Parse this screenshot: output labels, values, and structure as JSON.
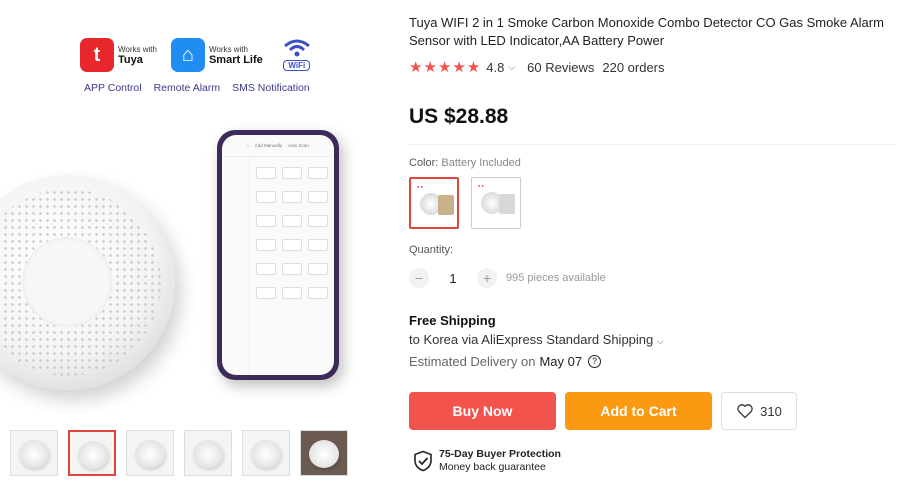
{
  "gallery": {
    "apps": [
      {
        "small": "Works with",
        "name": "Tuya",
        "icon": "tuya-app-icon"
      },
      {
        "small": "Works with",
        "name": "Smart Life",
        "icon": "smart-life-app-icon"
      }
    ],
    "wifi_badge": "WiFi",
    "captions": [
      "APP Control",
      "Remote Alarm",
      "SMS Notification"
    ],
    "thumbnail_count": 6
  },
  "product": {
    "title": "Tuya WIFI 2 in 1 Smoke Carbon Monoxide Combo Detector CO Gas Smoke Alarm Sensor with LED Indicator,AA Battery Power",
    "rating": "4.8",
    "stars": 5,
    "reviews": "60 Reviews",
    "orders": "220 orders",
    "price": "US $28.88"
  },
  "variant": {
    "label": "Color:",
    "selected": "Battery Included"
  },
  "quantity": {
    "label": "Quantity:",
    "minus": "−",
    "value": "1",
    "plus": "+",
    "available": "995 pieces available"
  },
  "shipping": {
    "title": "Free Shipping",
    "line": "to Korea via AliExpress Standard Shipping",
    "delivery_label": "Estimated Delivery on",
    "delivery_date": "May 07"
  },
  "actions": {
    "buy_now": "Buy Now",
    "add_to_cart": "Add to Cart",
    "wishlist_count": "310"
  },
  "protection": {
    "title": "75-Day Buyer Protection",
    "subtitle": "Money back guarantee"
  },
  "colors": {
    "accent_red": "#f2534d",
    "cart_orange": "#fb9a11",
    "star_red": "#f4524f"
  }
}
